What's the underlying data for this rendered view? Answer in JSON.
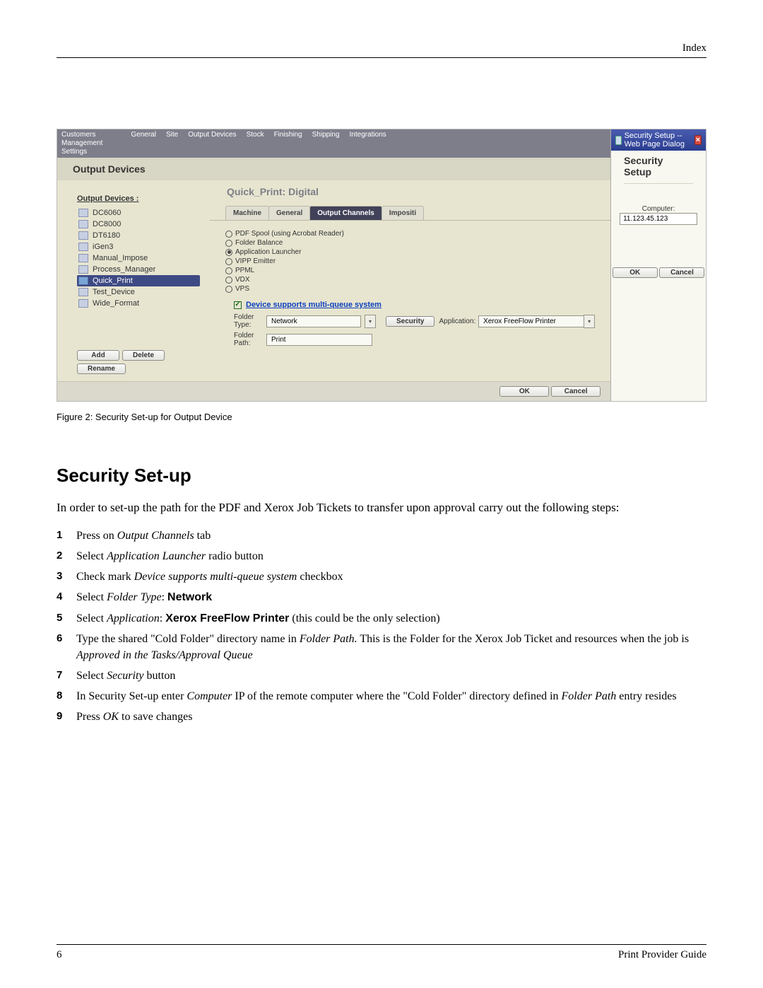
{
  "page": {
    "header_right": "Index",
    "page_number": "6",
    "footer_right": "Print Provider Guide"
  },
  "screenshot": {
    "top_tabs_left_1": "Customers",
    "top_tabs_left_2": "Management",
    "top_tabs_left_3": "Settings",
    "top_tabs": [
      "General",
      "Site",
      "Output Devices",
      "Stock",
      "Finishing",
      "Shipping",
      "Integrations"
    ],
    "breadcrumb": "Output Devices",
    "sidebar_title": "Output Devices :",
    "devices": [
      "DC6060",
      "DC8000",
      "DT6180",
      "iGen3",
      "Manual_Impose",
      "Process_Manager",
      "Quick_Print",
      "Test_Device",
      "Wide_Format"
    ],
    "device_selected_index": 6,
    "btn_add": "Add",
    "btn_delete": "Delete",
    "btn_rename": "Rename",
    "main_title": "Quick_Print: Digital",
    "mini_tabs": {
      "machine": "Machine",
      "general": "General",
      "output_channels": "Output Channels",
      "impositi": "Impositi"
    },
    "radios": [
      "PDF Spool (using Acrobat Reader)",
      "Folder Balance",
      "Application Launcher",
      "VIPP Emitter",
      "PPML",
      "VDX",
      "VPS"
    ],
    "radio_selected_index": 2,
    "cb_label": "Device supports multi-queue system",
    "folder_type_label": "Folder Type:",
    "folder_type_value": "Network",
    "folder_path_label": "Folder Path:",
    "folder_path_value": "Print",
    "security_btn": "Security",
    "application_label": "Application:",
    "application_value": "Xerox FreeFlow Printer",
    "ok": "OK",
    "cancel": "Cancel"
  },
  "dialog": {
    "titlebar": "Security Setup -- Web Page Dialog",
    "heading": "Security Setup",
    "computer_label": "Computer:",
    "computer_value": "11.123.45.123",
    "ok": "OK",
    "cancel": "Cancel"
  },
  "caption": "Figure 2: Security Set-up for Output Device",
  "doc": {
    "h2": "Security Set-up",
    "intro_a": "In order to set-up the path for the PDF and Xerox Job Tickets to transfer upon approval carry out the following steps:",
    "steps": {
      "s1_a": "Press on ",
      "s1_em": "Output Channels",
      "s1_b": " tab",
      "s2_a": "Select ",
      "s2_em": "Application Launcher",
      "s2_b": " radio button",
      "s3_a": "Check mark  ",
      "s3_em": "Device supports multi-queue system",
      "s3_b": "  checkbox",
      "s4_a": "Select ",
      "s4_em": "Folder Type",
      "s4_b": ": ",
      "s4_bold": "  Network",
      "s5_a": "Select ",
      "s5_em": "Application",
      "s5_b": ": ",
      "s5_bold": "Xerox FreeFlow Printer",
      "s5_c": " (this could be the only selection)",
      "s6_a": "Type the shared \"Cold Folder\" directory name in ",
      "s6_em": "Folder Path.",
      "s6_b": "  This is the Folder for the Xerox Job Ticket and resources when the job is ",
      "s6_em2": "Approved in the Tasks/Approval Queue",
      "s7_a": "Select ",
      "s7_em": "Security",
      "s7_b": " button",
      "s8_a": "In Security Set-up enter ",
      "s8_em": "Computer",
      "s8_b": " IP of the remote computer where the \"Cold Folder\" directory defined in ",
      "s8_em2": "Folder Path",
      "s8_c": " entry resides",
      "s9_a": "Press ",
      "s9_em": "OK",
      "s9_b": " to save changes"
    }
  }
}
